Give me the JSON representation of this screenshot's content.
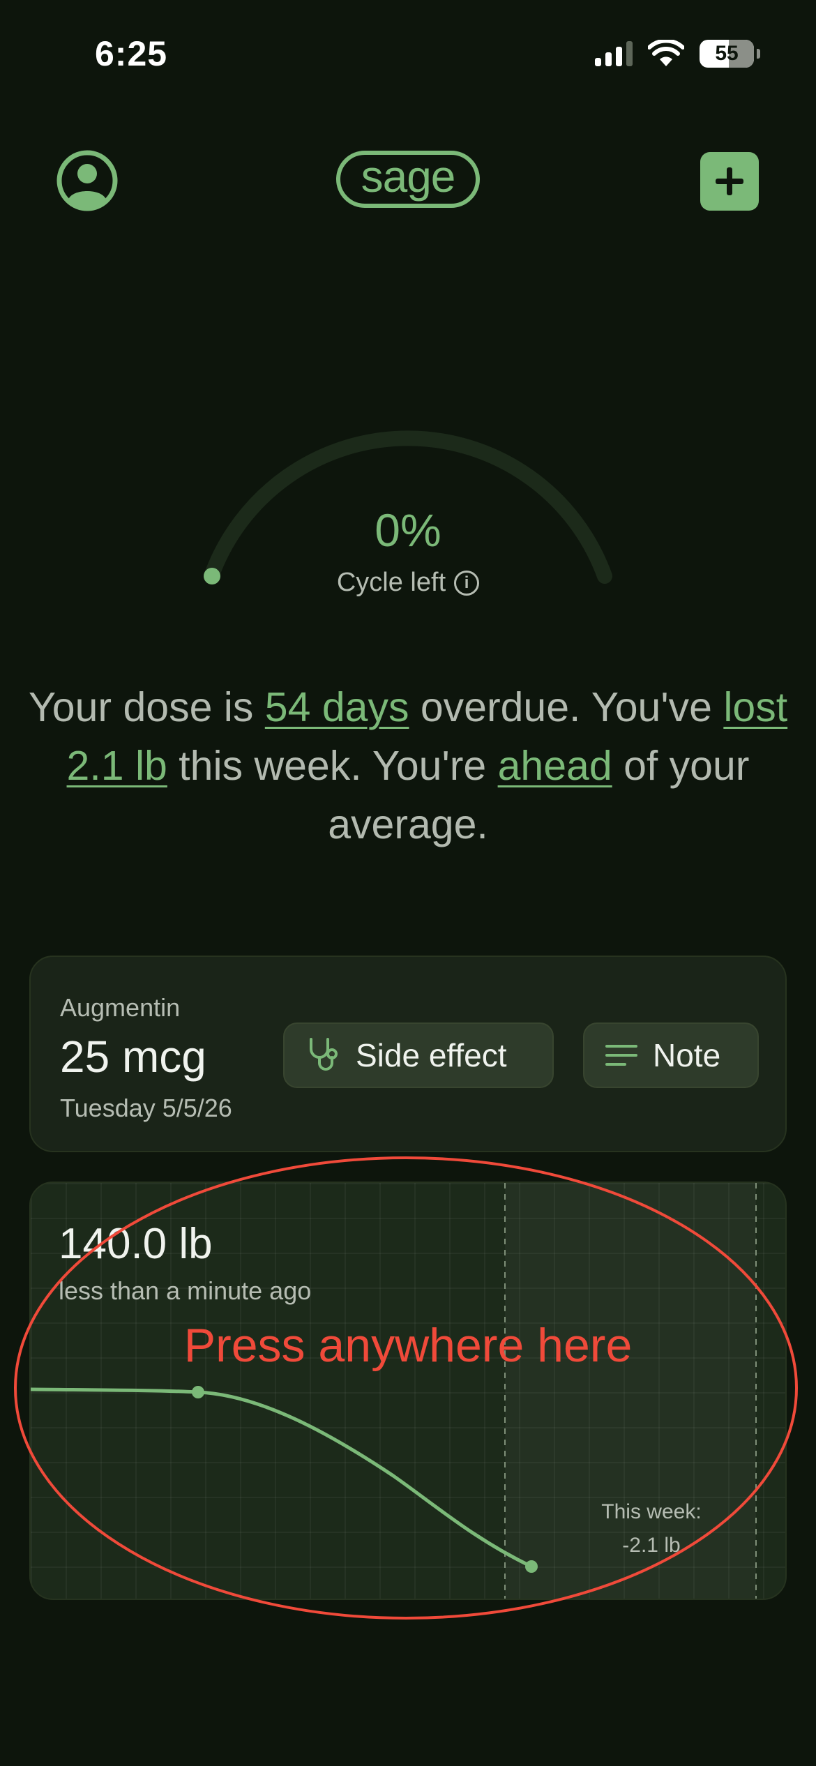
{
  "status_bar": {
    "time": "6:25",
    "battery": "55"
  },
  "header": {
    "logo": "sage"
  },
  "gauge": {
    "value": "0%",
    "label": "Cycle left",
    "fraction_left": 0.0
  },
  "summary": {
    "p1": "Your dose is ",
    "link_overdue": "54 days",
    "p2": " overdue. You've ",
    "link_lost": "lost 2.1 lb",
    "p3": " this week. You're ",
    "link_ahead": "ahead",
    "p4": " of your average."
  },
  "dose_card": {
    "medication": "Augmentin",
    "dose": "25 mcg",
    "date": "Tuesday 5/5/26",
    "side_effect_label": "Side effect",
    "note_label": "Note"
  },
  "weight_card": {
    "weight": "140.0 lb",
    "updated": "less than a minute ago",
    "week_label": "This week:",
    "week_change": "-2.1 lb"
  },
  "annotation": {
    "text": "Press anywhere here",
    "color": "#f04a3a"
  },
  "colors": {
    "accent": "#7bb978",
    "background": "#0d150c",
    "card": "#1a2418"
  }
}
